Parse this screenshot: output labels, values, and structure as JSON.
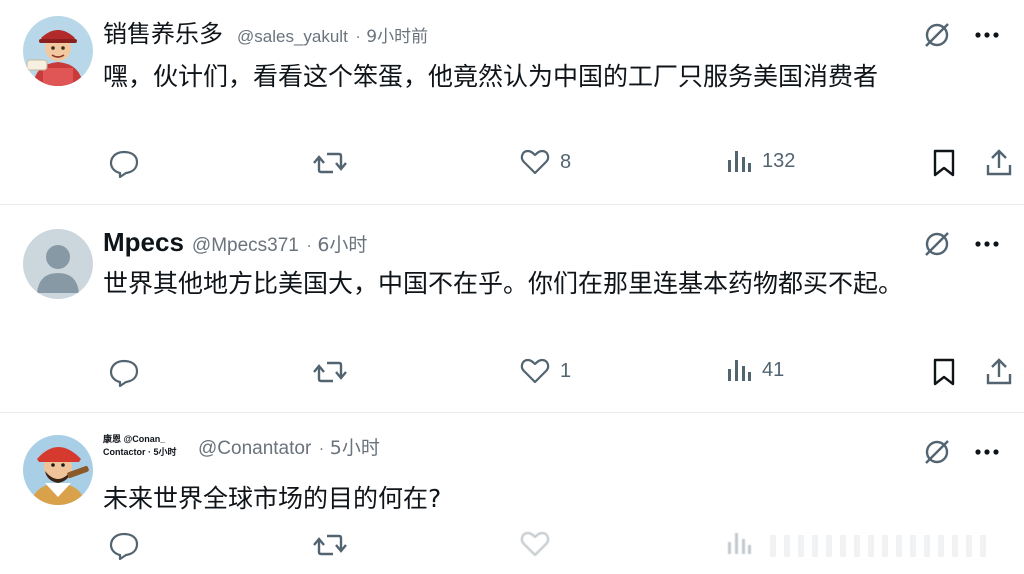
{
  "posts": [
    {
      "name": "销售养乐多",
      "handle": "@sales_yakult",
      "separator": "·",
      "time": "9小时前",
      "text": "嘿，伙计们，看看这个笨蛋，他竟然认为中国的工厂只服务美国消费者",
      "stats": {
        "likes": "8",
        "views": "132"
      },
      "avatar_icon": "cartoon-character-avatar"
    },
    {
      "name": "Mpecs",
      "handle": "@Mpecs371",
      "separator": "·",
      "time": "6小时",
      "text": "世界其他地方比美国大，中国不在乎。你们在那里连基本药物都买不起。",
      "stats": {
        "likes": "1",
        "views": "41"
      },
      "avatar_icon": "default-user-avatar"
    },
    {
      "name_line1": "康恩 @Conan_",
      "name_line2": "Contactor · 5小时",
      "handle": "@Conantator",
      "separator": "·",
      "time": "5小时",
      "text": "未来世界全球市场的目的何在?",
      "avatar_icon": "cartoon-pirate-avatar"
    }
  ],
  "icons": {
    "mute": "mute-icon",
    "more": "more-icon",
    "reply": "reply-icon",
    "retweet": "retweet-icon",
    "like": "heart-icon",
    "views": "views-icon",
    "bookmark": "bookmark-icon",
    "share": "share-icon"
  },
  "colors": {
    "text": "#0f1419",
    "muted": "#536471",
    "divider": "#e6ecf0"
  }
}
